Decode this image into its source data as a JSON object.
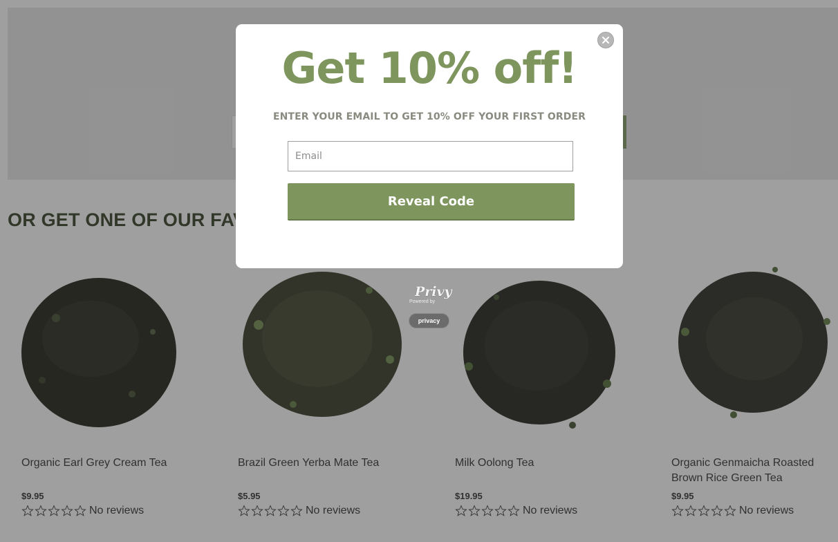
{
  "page": {
    "section_heading": "OR GET ONE OF OUR FAVORITES",
    "products": [
      {
        "name": "Organic Earl Grey Cream Tea",
        "price": "$9.95",
        "reviews": "No reviews"
      },
      {
        "name": "Brazil Green Yerba Mate Tea",
        "price": "$5.95",
        "reviews": "No reviews"
      },
      {
        "name": "Milk Oolong Tea",
        "price": "$19.95",
        "reviews": "No reviews"
      },
      {
        "name": "Organic Genmaicha Roasted Brown Rice Green Tea",
        "price": "$9.95",
        "reviews": "No reviews"
      }
    ]
  },
  "modal": {
    "title": "Get 10% off!",
    "subtitle": "ENTER YOUR EMAIL TO GET 10% OFF YOUR FIRST ORDER",
    "email_placeholder": "Email",
    "email_value": "",
    "reveal_button": "Reveal Code",
    "close_icon": "close-icon"
  },
  "branding": {
    "privy_logo": "Privy",
    "powered_by": "Powered by",
    "privacy_label": "privacy"
  },
  "colors": {
    "accent_green": "#7e965e",
    "overlay": "rgba(55,55,55,0.48)",
    "heading_dark": "#2e3a1e"
  }
}
